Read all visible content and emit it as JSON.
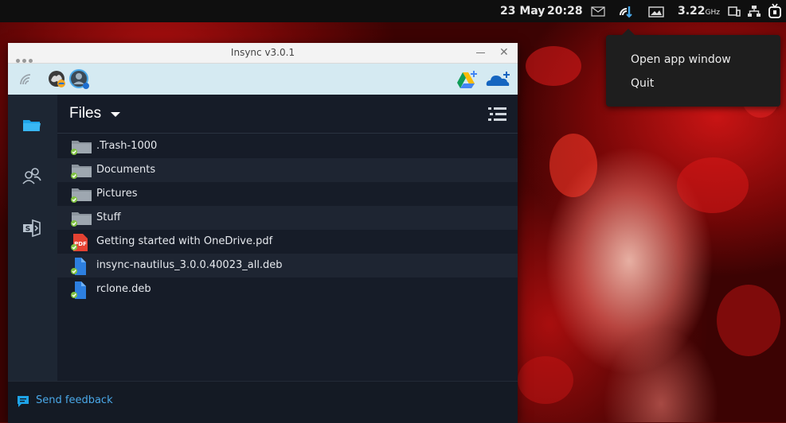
{
  "topbar": {
    "date": "23 May",
    "time": "20:28",
    "cpu_value": "3.22",
    "cpu_unit": "GHz"
  },
  "tray_menu": {
    "items": [
      {
        "label": "Open app window"
      },
      {
        "label": "Quit"
      }
    ]
  },
  "window": {
    "title": "Insync v3.0.1"
  },
  "main": {
    "header": "Files",
    "files": [
      {
        "name": ".Trash-1000",
        "type": "folder",
        "synced": true
      },
      {
        "name": "Documents",
        "type": "folder",
        "synced": true
      },
      {
        "name": "Pictures",
        "type": "folder",
        "synced": true
      },
      {
        "name": "Stuff",
        "type": "folder",
        "synced": true
      },
      {
        "name": "Getting started with OneDrive.pdf",
        "type": "pdf",
        "synced": true
      },
      {
        "name": "insync-nautilus_3.0.0.40023_all.deb",
        "type": "file",
        "synced": true
      },
      {
        "name": "rclone.deb",
        "type": "file",
        "synced": true
      }
    ]
  },
  "footer": {
    "feedback_label": "Send feedback"
  },
  "icons": {
    "pdf_badge": "PDF"
  },
  "colors": {
    "accent": "#4aa8e8",
    "sync_check": "#7fc241",
    "pdf_red": "#e44232",
    "file_blue": "#2d7fe0",
    "folder_gray": "#8c959e"
  }
}
